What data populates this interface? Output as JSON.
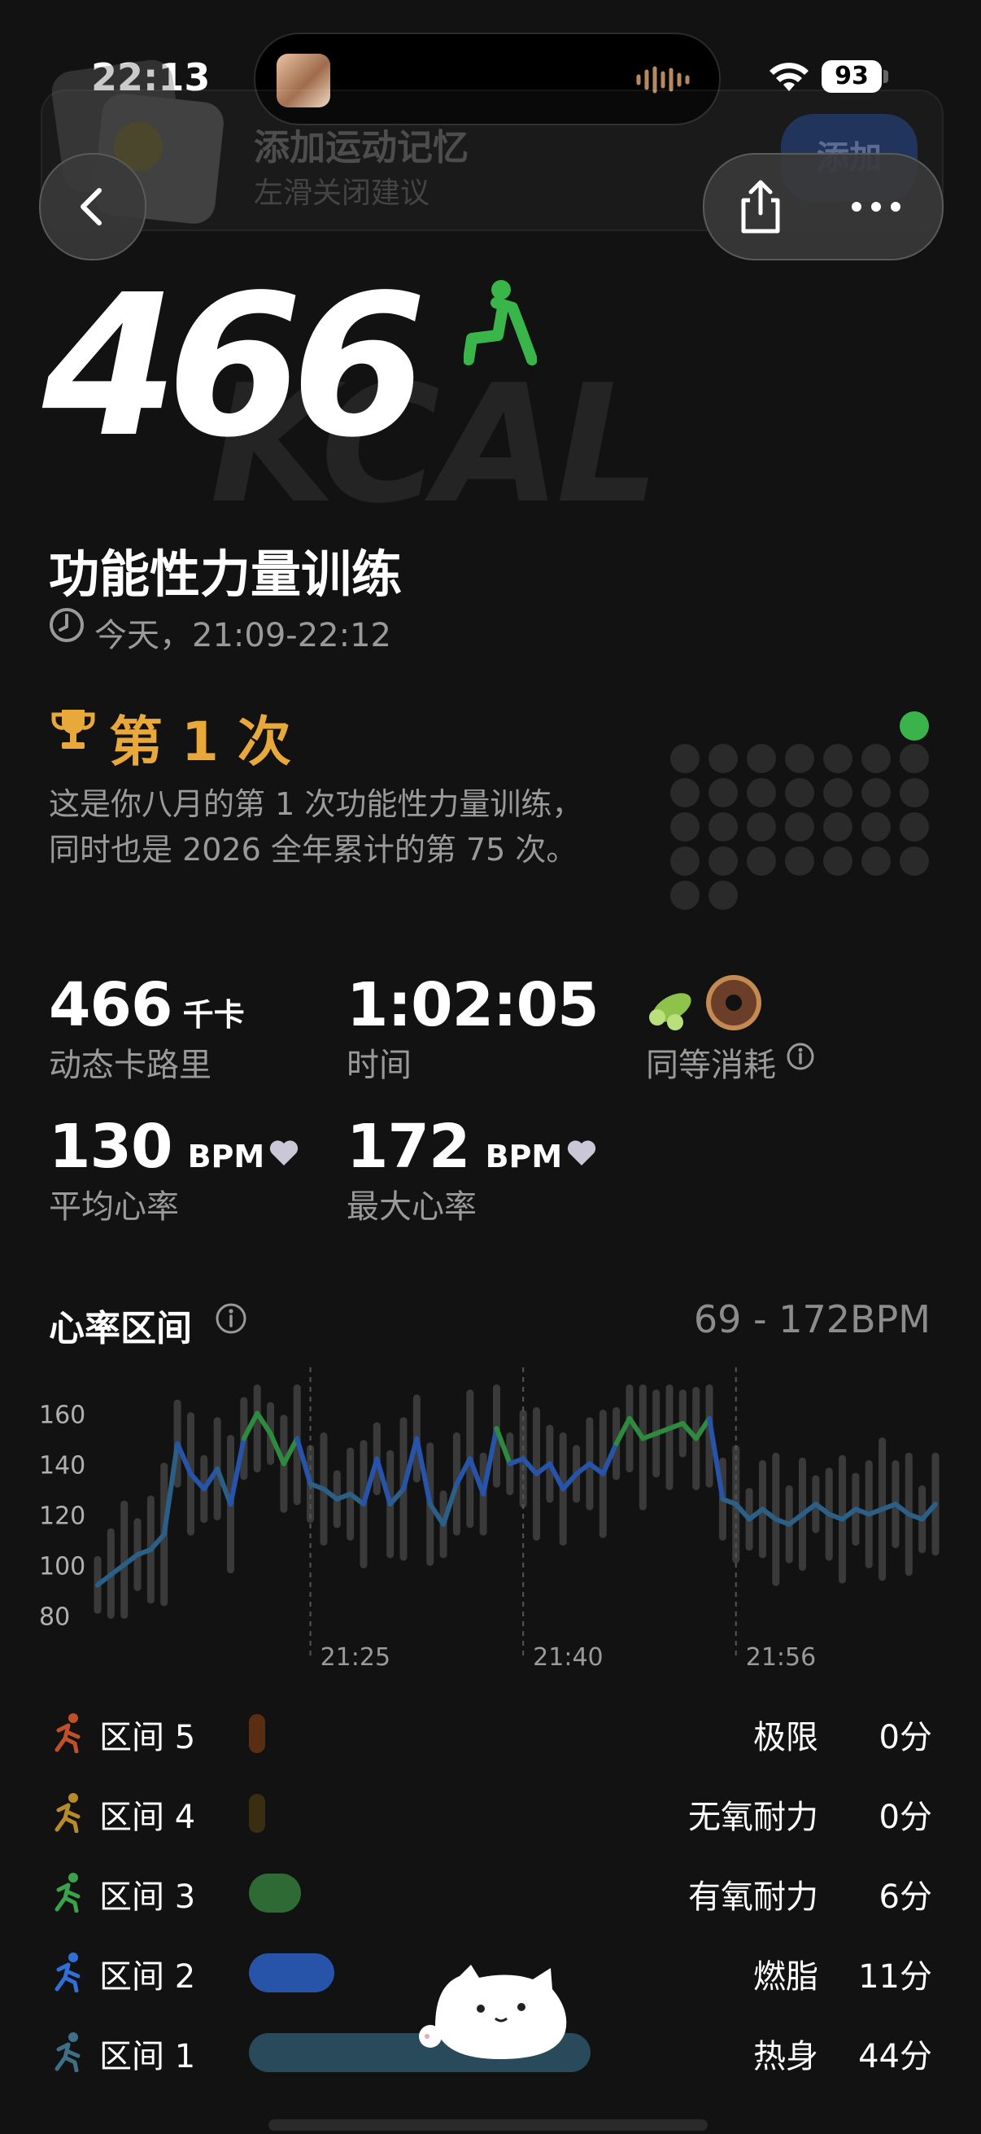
{
  "status_bar": {
    "time": "22:13",
    "battery": "93"
  },
  "banner": {
    "title": "添加运动记忆",
    "subtitle": "左滑关闭建议",
    "button": "添加"
  },
  "hero": {
    "calories": "466",
    "unit_bg": "KCAL"
  },
  "workout": {
    "title": "功能性力量训练",
    "time_range": "今天，21:09-22:12"
  },
  "achievement": {
    "title": "第 1 次",
    "line1": "这是你八月的第 1 次功能性力量训练，",
    "line2": "同时也是 2026 全年累计的第 75 次。"
  },
  "stats": {
    "active_cal": {
      "value": "466",
      "unit": "千卡",
      "label": "动态卡路里"
    },
    "duration": {
      "value": "1:02:05",
      "label": "时间"
    },
    "equivalent": {
      "label": "同等消耗"
    },
    "avg_hr": {
      "value": "130",
      "unit": "BPM",
      "label": "平均心率"
    },
    "max_hr": {
      "value": "172",
      "unit": "BPM",
      "label": "最大心率"
    }
  },
  "hr_zone": {
    "title": "心率区间",
    "range": "69 - 172BPM"
  },
  "chart_data": {
    "type": "line",
    "y_ticks": [
      "160",
      "140",
      "120",
      "100",
      "80"
    ],
    "ylim": [
      75,
      175
    ],
    "x_tick_labels": [
      "21:25",
      "21:40",
      "21:56"
    ],
    "series": [
      {
        "values": [
          92,
          96,
          100,
          104,
          106,
          112,
          148,
          136,
          130,
          138,
          124,
          150,
          160,
          152,
          140,
          150,
          132,
          130,
          126,
          128,
          124,
          142,
          124,
          130,
          150,
          124,
          116,
          132,
          142,
          128,
          154,
          140,
          142,
          136,
          140,
          130,
          136,
          140,
          136,
          148,
          158,
          150,
          152,
          154,
          156,
          150,
          158,
          126,
          124,
          118,
          122,
          118,
          116,
          120,
          124,
          120,
          118,
          122,
          120,
          122,
          124,
          120,
          118,
          124
        ]
      }
    ]
  },
  "zones": [
    {
      "label": "区间 5",
      "name": "极限",
      "value": "0分",
      "color": "#5a2e12",
      "frac": 0.0
    },
    {
      "label": "区间 4",
      "name": "无氧耐力",
      "value": "0分",
      "color": "#3a2e12",
      "frac": 0.0
    },
    {
      "label": "区间 3",
      "name": "有氧耐力",
      "value": "6分",
      "color": "#2e6b34",
      "frac": 0.136
    },
    {
      "label": "区间 2",
      "name": "燃脂",
      "value": "11分",
      "color": "#2753a8",
      "frac": 0.25
    },
    {
      "label": "区间 1",
      "name": "热身",
      "value": "44分",
      "color": "#294a5b",
      "frac": 1.0
    }
  ]
}
